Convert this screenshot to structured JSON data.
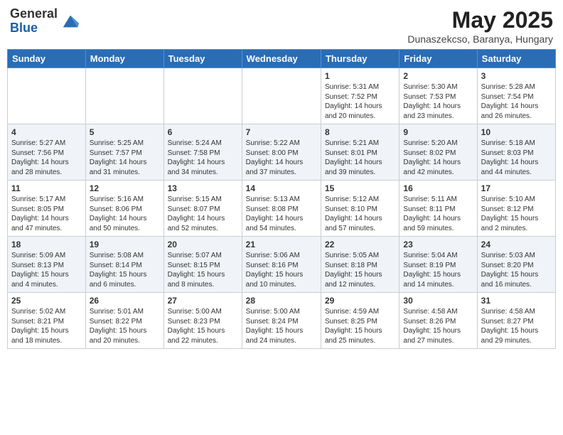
{
  "header": {
    "logo_general": "General",
    "logo_blue": "Blue",
    "title": "May 2025",
    "location": "Dunaszekcso, Baranya, Hungary"
  },
  "days_of_week": [
    "Sunday",
    "Monday",
    "Tuesday",
    "Wednesday",
    "Thursday",
    "Friday",
    "Saturday"
  ],
  "weeks": [
    [
      {
        "day": "",
        "content": ""
      },
      {
        "day": "",
        "content": ""
      },
      {
        "day": "",
        "content": ""
      },
      {
        "day": "",
        "content": ""
      },
      {
        "day": "1",
        "content": "Sunrise: 5:31 AM\nSunset: 7:52 PM\nDaylight: 14 hours\nand 20 minutes."
      },
      {
        "day": "2",
        "content": "Sunrise: 5:30 AM\nSunset: 7:53 PM\nDaylight: 14 hours\nand 23 minutes."
      },
      {
        "day": "3",
        "content": "Sunrise: 5:28 AM\nSunset: 7:54 PM\nDaylight: 14 hours\nand 26 minutes."
      }
    ],
    [
      {
        "day": "4",
        "content": "Sunrise: 5:27 AM\nSunset: 7:56 PM\nDaylight: 14 hours\nand 28 minutes."
      },
      {
        "day": "5",
        "content": "Sunrise: 5:25 AM\nSunset: 7:57 PM\nDaylight: 14 hours\nand 31 minutes."
      },
      {
        "day": "6",
        "content": "Sunrise: 5:24 AM\nSunset: 7:58 PM\nDaylight: 14 hours\nand 34 minutes."
      },
      {
        "day": "7",
        "content": "Sunrise: 5:22 AM\nSunset: 8:00 PM\nDaylight: 14 hours\nand 37 minutes."
      },
      {
        "day": "8",
        "content": "Sunrise: 5:21 AM\nSunset: 8:01 PM\nDaylight: 14 hours\nand 39 minutes."
      },
      {
        "day": "9",
        "content": "Sunrise: 5:20 AM\nSunset: 8:02 PM\nDaylight: 14 hours\nand 42 minutes."
      },
      {
        "day": "10",
        "content": "Sunrise: 5:18 AM\nSunset: 8:03 PM\nDaylight: 14 hours\nand 44 minutes."
      }
    ],
    [
      {
        "day": "11",
        "content": "Sunrise: 5:17 AM\nSunset: 8:05 PM\nDaylight: 14 hours\nand 47 minutes."
      },
      {
        "day": "12",
        "content": "Sunrise: 5:16 AM\nSunset: 8:06 PM\nDaylight: 14 hours\nand 50 minutes."
      },
      {
        "day": "13",
        "content": "Sunrise: 5:15 AM\nSunset: 8:07 PM\nDaylight: 14 hours\nand 52 minutes."
      },
      {
        "day": "14",
        "content": "Sunrise: 5:13 AM\nSunset: 8:08 PM\nDaylight: 14 hours\nand 54 minutes."
      },
      {
        "day": "15",
        "content": "Sunrise: 5:12 AM\nSunset: 8:10 PM\nDaylight: 14 hours\nand 57 minutes."
      },
      {
        "day": "16",
        "content": "Sunrise: 5:11 AM\nSunset: 8:11 PM\nDaylight: 14 hours\nand 59 minutes."
      },
      {
        "day": "17",
        "content": "Sunrise: 5:10 AM\nSunset: 8:12 PM\nDaylight: 15 hours\nand 2 minutes."
      }
    ],
    [
      {
        "day": "18",
        "content": "Sunrise: 5:09 AM\nSunset: 8:13 PM\nDaylight: 15 hours\nand 4 minutes."
      },
      {
        "day": "19",
        "content": "Sunrise: 5:08 AM\nSunset: 8:14 PM\nDaylight: 15 hours\nand 6 minutes."
      },
      {
        "day": "20",
        "content": "Sunrise: 5:07 AM\nSunset: 8:15 PM\nDaylight: 15 hours\nand 8 minutes."
      },
      {
        "day": "21",
        "content": "Sunrise: 5:06 AM\nSunset: 8:16 PM\nDaylight: 15 hours\nand 10 minutes."
      },
      {
        "day": "22",
        "content": "Sunrise: 5:05 AM\nSunset: 8:18 PM\nDaylight: 15 hours\nand 12 minutes."
      },
      {
        "day": "23",
        "content": "Sunrise: 5:04 AM\nSunset: 8:19 PM\nDaylight: 15 hours\nand 14 minutes."
      },
      {
        "day": "24",
        "content": "Sunrise: 5:03 AM\nSunset: 8:20 PM\nDaylight: 15 hours\nand 16 minutes."
      }
    ],
    [
      {
        "day": "25",
        "content": "Sunrise: 5:02 AM\nSunset: 8:21 PM\nDaylight: 15 hours\nand 18 minutes."
      },
      {
        "day": "26",
        "content": "Sunrise: 5:01 AM\nSunset: 8:22 PM\nDaylight: 15 hours\nand 20 minutes."
      },
      {
        "day": "27",
        "content": "Sunrise: 5:00 AM\nSunset: 8:23 PM\nDaylight: 15 hours\nand 22 minutes."
      },
      {
        "day": "28",
        "content": "Sunrise: 5:00 AM\nSunset: 8:24 PM\nDaylight: 15 hours\nand 24 minutes."
      },
      {
        "day": "29",
        "content": "Sunrise: 4:59 AM\nSunset: 8:25 PM\nDaylight: 15 hours\nand 25 minutes."
      },
      {
        "day": "30",
        "content": "Sunrise: 4:58 AM\nSunset: 8:26 PM\nDaylight: 15 hours\nand 27 minutes."
      },
      {
        "day": "31",
        "content": "Sunrise: 4:58 AM\nSunset: 8:27 PM\nDaylight: 15 hours\nand 29 minutes."
      }
    ]
  ]
}
